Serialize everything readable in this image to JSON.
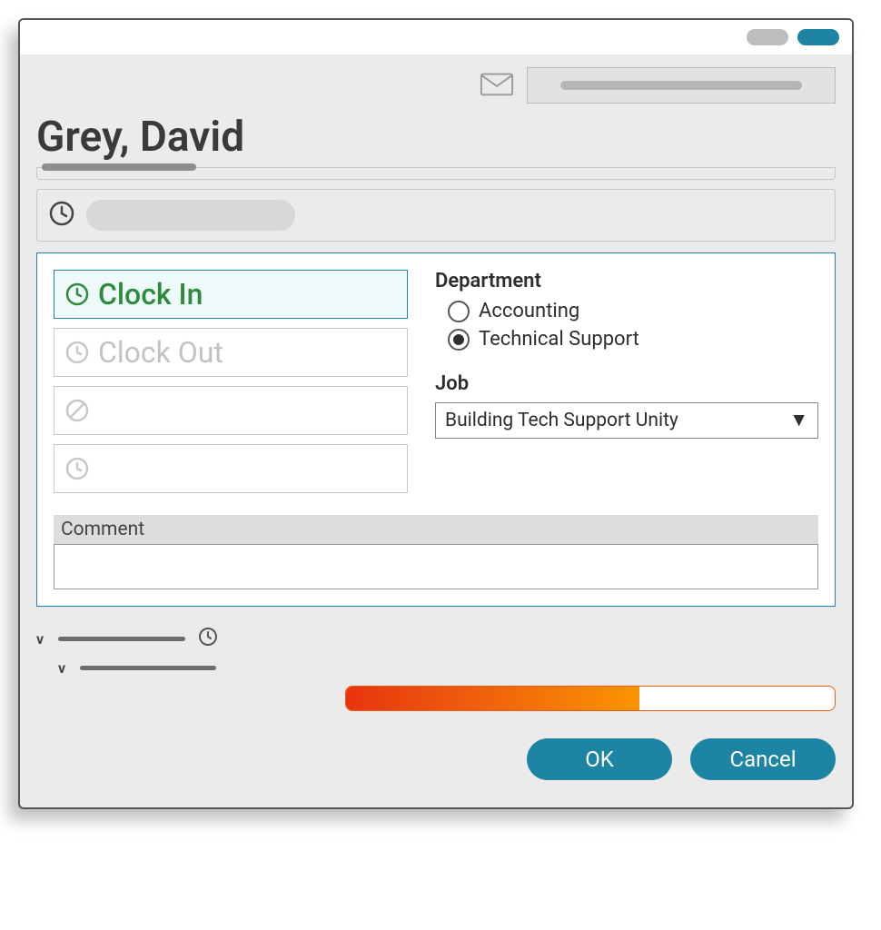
{
  "employee_name": "Grey, David",
  "actions": {
    "clock_in": "Clock In",
    "clock_out": "Clock Out"
  },
  "department": {
    "label": "Department",
    "options": [
      "Accounting",
      "Technical Support"
    ],
    "selected": "Technical Support"
  },
  "job": {
    "label": "Job",
    "selected": "Building Tech Support Unity"
  },
  "comment": {
    "label": "Comment",
    "value": ""
  },
  "progress": {
    "percent": 60
  },
  "buttons": {
    "ok": "OK",
    "cancel": "Cancel"
  }
}
